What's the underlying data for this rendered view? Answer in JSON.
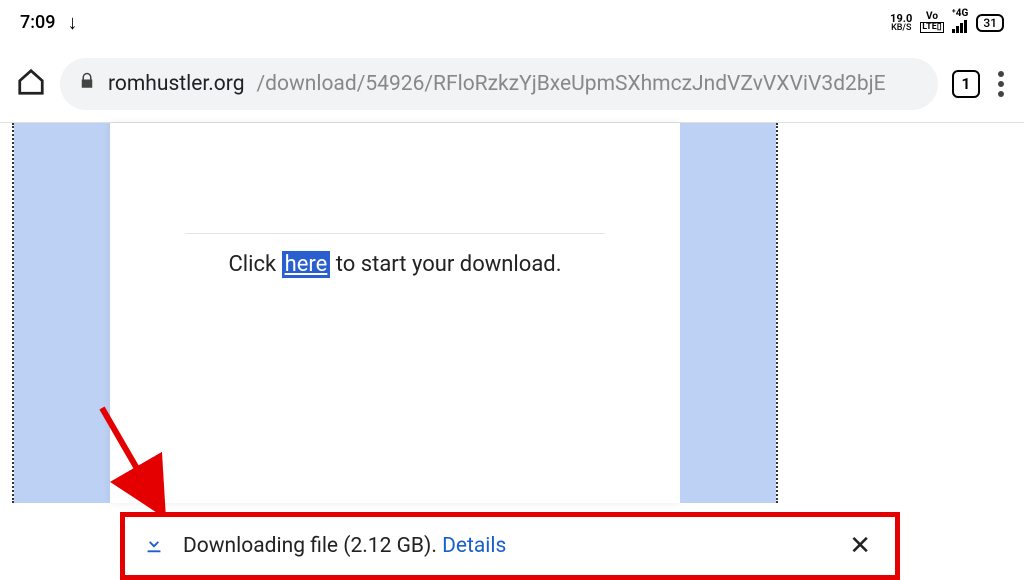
{
  "status": {
    "time": "7:09",
    "kbs_value": "19.0",
    "kbs_label": "KB/S",
    "volte_top": "Vo",
    "volte_bot": "LTE▯",
    "net_label": "⁺4G",
    "battery": "31"
  },
  "browser": {
    "url_origin": "romhustler.org",
    "url_path": "/download/54926/RFloRzkzYjBxeUpmSXhmczJndVZvVXViV3d2bjE",
    "tab_count": "1"
  },
  "page": {
    "before": "Click ",
    "link": "here",
    "after": " to start your download."
  },
  "downloadbar": {
    "text_prefix": "Downloading file (",
    "size": "2.12 GB",
    "text_suffix": "). ",
    "details": "Details"
  }
}
